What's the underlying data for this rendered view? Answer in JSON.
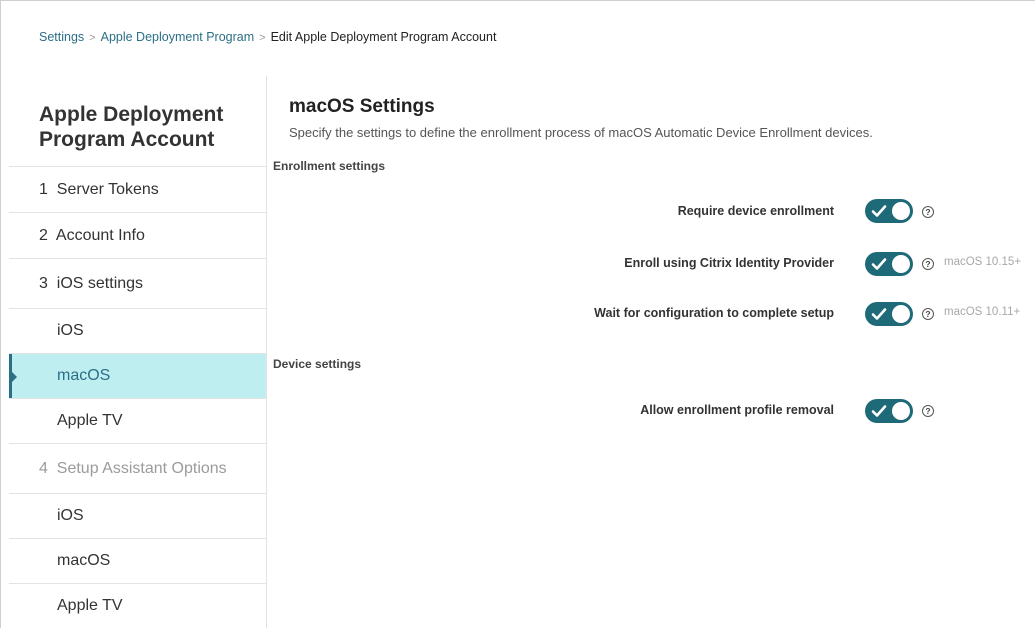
{
  "breadcrumb": {
    "items": [
      "Settings",
      "Apple Deployment Program",
      "Edit Apple Deployment Program Account"
    ],
    "separator": ">"
  },
  "sidebar": {
    "title_line1": "Apple Deployment",
    "title_line2": "Program Account",
    "items": [
      {
        "label": "1  Server Tokens"
      },
      {
        "label": "2  Account Info"
      },
      {
        "label": "3  iOS settings"
      },
      {
        "label": "iOS"
      },
      {
        "label": "macOS"
      },
      {
        "label": "Apple TV"
      },
      {
        "label": "4  Setup Assistant Options"
      },
      {
        "label": "iOS"
      },
      {
        "label": "macOS"
      },
      {
        "label": "Apple TV"
      }
    ]
  },
  "main": {
    "title": "macOS Settings",
    "description": "Specify the settings to define the enrollment process of macOS Automatic Device Enrollment devices.",
    "sections": [
      {
        "label": "Enrollment settings",
        "rows": [
          {
            "label": "Require device enrollment",
            "enabled": true,
            "version": ""
          },
          {
            "label": "Enroll using Citrix Identity Provider",
            "enabled": true,
            "version": "macOS 10.15+"
          },
          {
            "label": "Wait for configuration to complete setup",
            "enabled": true,
            "version": "macOS 10.11+"
          }
        ]
      },
      {
        "label": "Device settings",
        "rows": [
          {
            "label": "Allow enrollment profile removal",
            "enabled": true,
            "version": ""
          }
        ]
      }
    ],
    "help_glyph": "?"
  },
  "colors": {
    "accent": "#2b6f86",
    "toggle_on": "#1f6a78",
    "active_bg": "#bfeef0"
  },
  "icons": {
    "toggle_check": "check-icon",
    "help": "help-icon",
    "breadcrumb_separator": "chevron-right-icon"
  }
}
